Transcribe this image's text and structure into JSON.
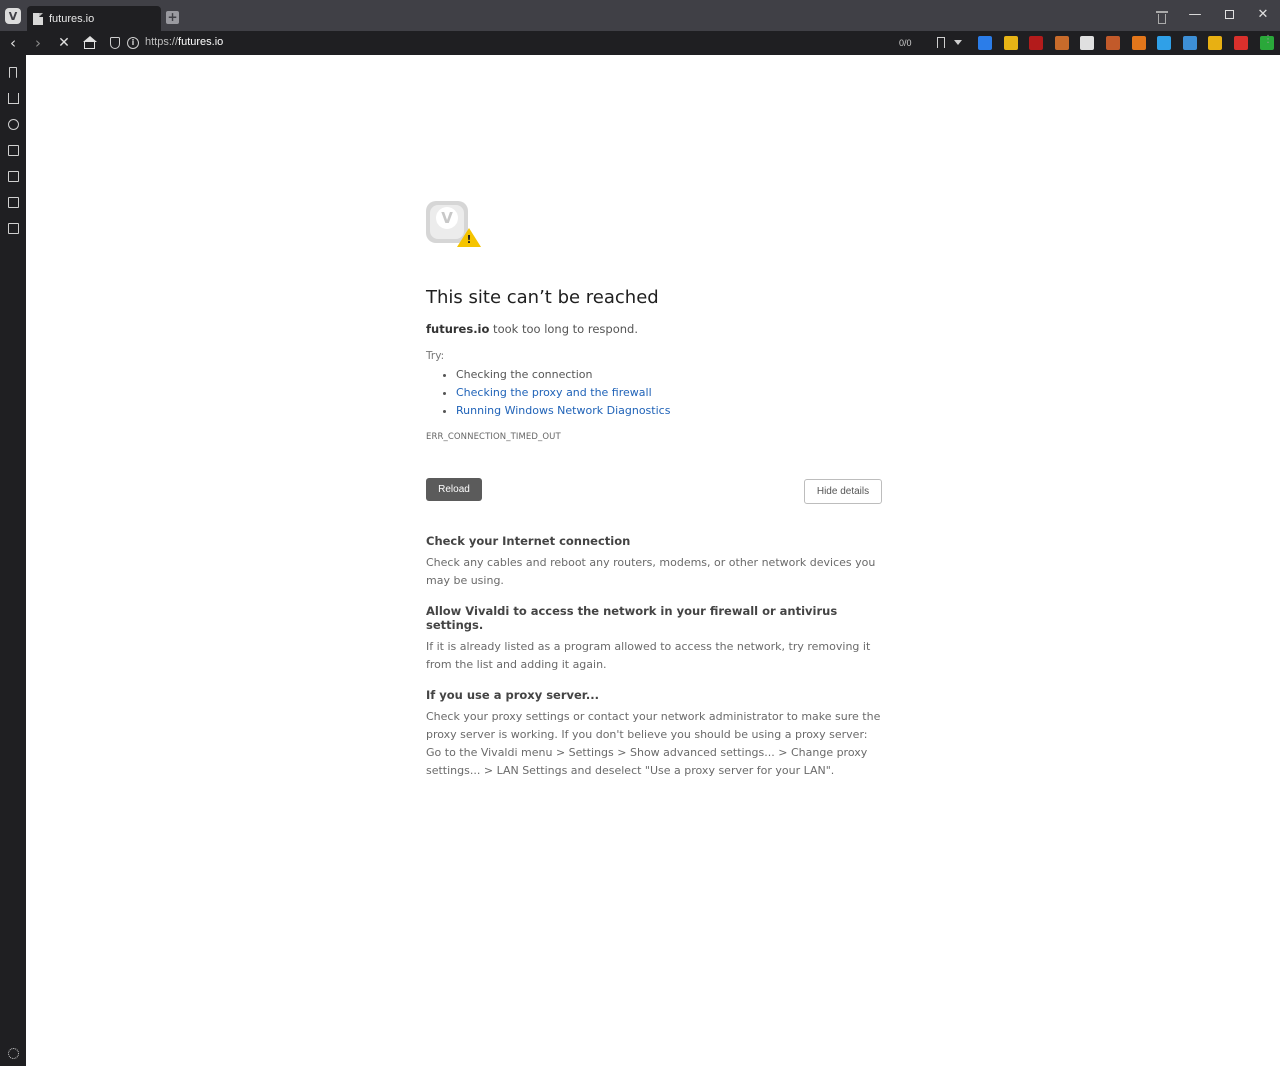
{
  "browser": {
    "tab_title": "futures.io",
    "new_tab_symbol": "+",
    "url_prefix": "https://",
    "url_host": "futures.io",
    "blocker_counter": "0/0",
    "window": {
      "minimize": "—",
      "close": "✕"
    },
    "nav": {
      "back": "‹",
      "forward": "›",
      "stop": "✕"
    }
  },
  "extensions": [
    {
      "icon": "blue-bookmark-icon",
      "color": "#2b7de9"
    },
    {
      "icon": "folder-extension-icon",
      "color": "#e7b416"
    },
    {
      "icon": "ublock-icon",
      "color": "#b31b1b"
    },
    {
      "icon": "monkey-icon",
      "color": "#c86b2b"
    },
    {
      "icon": "screen-capture-icon",
      "color": "#e0e0e0"
    },
    {
      "icon": "fox-icon",
      "color": "#c25a2a"
    },
    {
      "icon": "metamask-icon",
      "color": "#e2761b"
    },
    {
      "icon": "water-drop-icon",
      "color": "#2fa0e8"
    },
    {
      "icon": "image-extension-icon",
      "color": "#3d8fd6"
    },
    {
      "icon": "chart-extension-icon",
      "color": "#e8b012"
    },
    {
      "icon": "camera-record-icon",
      "color": "#d9302c"
    },
    {
      "icon": "green-leaf-icon",
      "color": "#2aa83a"
    }
  ],
  "error_page": {
    "title": "This site can’t be reached",
    "host": "futures.io",
    "message": " took too long to respond.",
    "try_label": "Try:",
    "suggestions": [
      {
        "text": "Checking the connection",
        "link": false
      },
      {
        "text": "Checking the proxy and the firewall",
        "link": true
      },
      {
        "text": "Running Windows Network Diagnostics",
        "link": true
      }
    ],
    "error_code": "ERR_CONNECTION_TIMED_OUT",
    "reload_label": "Reload",
    "hide_details_label": "Hide details",
    "details": [
      {
        "title": "Check your Internet connection",
        "body": "Check any cables and reboot any routers, modems, or other network devices you may be using."
      },
      {
        "title": "Allow Vivaldi to access the network in your firewall or antivirus settings.",
        "body": "If it is already listed as a program allowed to access the network, try removing it from the list and adding it again."
      },
      {
        "title": "If you use a proxy server...",
        "body": "Check your proxy settings or contact your network administrator to make sure the proxy server is working. If you don't believe you should be using a proxy server: Go to the Vivaldi menu > Settings > Show advanced settings... > Change proxy settings... > LAN Settings and deselect \"Use a proxy server for your LAN\"."
      }
    ]
  }
}
